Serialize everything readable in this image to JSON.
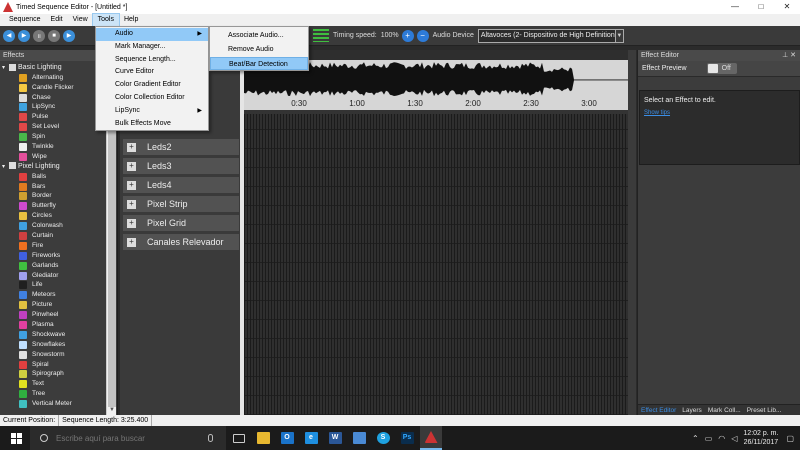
{
  "window": {
    "title": "Timed Sequence Editor - [Untitled *]",
    "min": "—",
    "max": "□",
    "close": "✕"
  },
  "menubar": [
    "Sequence",
    "Edit",
    "View",
    "Tools",
    "Help"
  ],
  "tools_menu": [
    {
      "label": "Audio",
      "has_submenu": true,
      "highlighted": true
    },
    {
      "label": "Mark Manager..."
    },
    {
      "label": "Sequence Length..."
    },
    {
      "label": "Curve Editor"
    },
    {
      "label": "Color Gradient Editor"
    },
    {
      "label": "Color Collection Editor"
    },
    {
      "label": "LipSync",
      "has_submenu": true
    },
    {
      "label": "Bulk Effects Move"
    }
  ],
  "audio_submenu": [
    {
      "label": "Associate Audio..."
    },
    {
      "label": "Remove Audio"
    },
    {
      "label": "Beat/Bar Detection",
      "highlighted": true
    }
  ],
  "toolbar": {
    "timing_label": "Timing speed:",
    "timing_value": "100%",
    "zoom_in": "+",
    "zoom_out": "−",
    "audio_device_label": "Audio Device",
    "audio_device_value": "Altavoces (2- Dispositivo de High Definition"
  },
  "effects_panel": {
    "title": "Effects",
    "groups": [
      {
        "name": "Basic Lighting",
        "items": [
          {
            "name": "Alternating",
            "color": "#e0a020"
          },
          {
            "name": "Candle Flicker",
            "color": "#f5c842"
          },
          {
            "name": "Chase",
            "color": "#dddddd"
          },
          {
            "name": "LipSync",
            "color": "#3fa3e0"
          },
          {
            "name": "Pulse",
            "color": "#e04848"
          },
          {
            "name": "Set Level",
            "color": "#e04848"
          },
          {
            "name": "Spin",
            "color": "#49b84a"
          },
          {
            "name": "Twinkle",
            "color": "#f0f0f0"
          },
          {
            "name": "Wipe",
            "color": "#e44f9b"
          }
        ]
      },
      {
        "name": "Pixel Lighting",
        "items": [
          {
            "name": "Balls",
            "color": "#e04040"
          },
          {
            "name": "Bars",
            "color": "#e07b20"
          },
          {
            "name": "Border",
            "color": "#d0a030"
          },
          {
            "name": "Butterfly",
            "color": "#d04ad0"
          },
          {
            "name": "Circles",
            "color": "#e8c040"
          },
          {
            "name": "Colorwash",
            "color": "#40a0e0"
          },
          {
            "name": "Curtain",
            "color": "#d04040"
          },
          {
            "name": "Fire",
            "color": "#f07020"
          },
          {
            "name": "Fireworks",
            "color": "#4060e0"
          },
          {
            "name": "Garlands",
            "color": "#40c040"
          },
          {
            "name": "Glediator",
            "color": "#a0a0f0"
          },
          {
            "name": "Life",
            "color": "#202020"
          },
          {
            "name": "Meteors",
            "color": "#4080e0"
          },
          {
            "name": "Picture",
            "color": "#e0c040"
          },
          {
            "name": "Pinwheel",
            "color": "#c040c0"
          },
          {
            "name": "Plasma",
            "color": "#e040a0"
          },
          {
            "name": "Shockwave",
            "color": "#40a0e0"
          },
          {
            "name": "Snowflakes",
            "color": "#c0e0ff"
          },
          {
            "name": "Snowstorm",
            "color": "#e0e0e0"
          },
          {
            "name": "Spiral",
            "color": "#e04040"
          },
          {
            "name": "Spirograph",
            "color": "#d0d040"
          },
          {
            "name": "Text",
            "color": "#e0e020"
          },
          {
            "name": "Tree",
            "color": "#30b040"
          },
          {
            "name": "Vertical Meter",
            "color": "#40c0c0"
          }
        ]
      }
    ]
  },
  "timeline": {
    "rows": [
      "Leds2",
      "Leds3",
      "Leds4",
      "Pixel Strip",
      "Pixel Grid",
      "Canales Relevador"
    ],
    "ticks": [
      "0:30",
      "1:00",
      "1:30",
      "2:00",
      "2:30",
      "3:00"
    ]
  },
  "effect_editor": {
    "title": "Effect Editor",
    "pin": "⊥",
    "close": "✕",
    "preview_label": "Effect Preview",
    "preview_state": "Off",
    "message": "Select an Effect to edit.",
    "link": "Show tips",
    "tabs": [
      "Effect Editor",
      "Layers",
      "Mark Coll...",
      "Preset Lib..."
    ]
  },
  "statusbar": {
    "current_position": "Current Position:",
    "sequence_length": "Sequence Length:  3:25.400"
  },
  "taskbar": {
    "search_placeholder": "Escribe aquí para buscar",
    "time": "12:02 p. m.",
    "date": "26/11/2017",
    "apps": [
      "task-view",
      "file-explorer",
      "outlook",
      "edge",
      "word",
      "store",
      "skype",
      "photoshop",
      "xlights"
    ]
  }
}
